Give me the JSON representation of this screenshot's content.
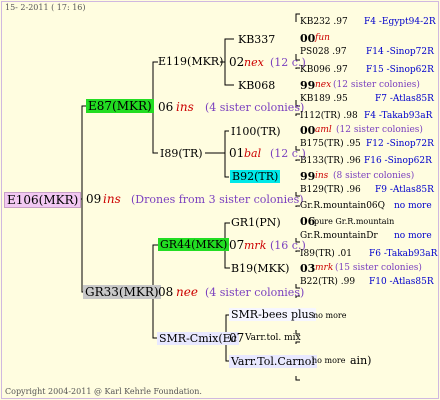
{
  "header": {
    "text": "15- 2-2011 ( 17: 16)"
  },
  "footer": {
    "text": "Copyright 2004-2011 @ Karl Kehrle Foundation."
  },
  "colors": {
    "root_bg": "#f2c8f2",
    "green_bg": "#22dd22",
    "gray_bg": "#c8c8c8",
    "cyan_bg": "#00e8e8",
    "light_bg": "#e8e8ff"
  },
  "root": {
    "label": "E106(MKR)",
    "num": "09",
    "note": "ins",
    "sub": "(Drones from 3 sister colonies)"
  },
  "top": {
    "label": "E87(MKR)",
    "num": "06",
    "note": "ins",
    "sub": "(4 sister colonies)",
    "a": {
      "label": "E119(MKR)",
      "num": "02",
      "note": "nex",
      "sub": "(12 c.)",
      "a": {
        "label": "KB337",
        "ids": [
          "KB232 .97",
          "00",
          "PS028 .97"
        ],
        "note": "fun",
        "right": [
          "F4 -Egypt94-2R",
          "F14 -Sinop72R"
        ]
      },
      "b": {
        "label": "KB068",
        "ids": [
          "KB096 .97",
          "99",
          "KB189 .95"
        ],
        "note": "nex",
        "sub": "(12 sister colonies)",
        "right": [
          "F15 -Sinop62R",
          "F7 -Atlas85R"
        ]
      }
    },
    "b": {
      "label": "I89(TR)",
      "num": "01",
      "note": "bal",
      "sub": "(12 c.)",
      "a": {
        "label": "I100(TR)",
        "ids": [
          "I112(TR) .98",
          "00",
          "B175(TR) .95"
        ],
        "note": "aml",
        "sub": "(12 sister colonies)",
        "right": [
          "F4 -Takab93aR",
          "F12 -Sinop72R"
        ]
      },
      "b": {
        "label": "B92(TR)",
        "ids": [
          "B133(TR) .96",
          "99",
          "B129(TR) .96"
        ],
        "note": "ins",
        "sub": "(8 sister colonies)",
        "right": [
          "F16 -Sinop62R",
          "F9 -Atlas85R"
        ]
      }
    }
  },
  "bottom": {
    "label": "GR33(MKR)",
    "num": "08",
    "note": "nee",
    "sub": "(4 sister colonies)",
    "a": {
      "label": "GR44(MKK)",
      "num": "07",
      "note": "mrk",
      "sub": "(16 c.)",
      "a": {
        "label": "GR1(PN)",
        "ids": [
          "Gr.R.mountain06Q",
          "06",
          "Gr.R.mountainDr"
        ],
        "mid": "pure Gr.R.mountain",
        "right": [
          "no more",
          "no more"
        ]
      },
      "b": {
        "label": "B19(MKK)",
        "ids": [
          "I89(TR) .01",
          "03",
          "B22(TR) .99"
        ],
        "note": "mrk",
        "sub": "(15 sister colonies)",
        "right": [
          "F6 -Takab93aR",
          "F10 -Atlas85R"
        ]
      }
    },
    "b": {
      "label": "SMR-Cmix(Ec",
      "num": "07",
      "mid": "Varr.tol. mix",
      "a": {
        "label": "SMR-bees plus",
        "right": "no more"
      },
      "b": {
        "label": "Varr.Tol.Carnol",
        "right": "no more",
        "tail": "ain)"
      }
    }
  }
}
